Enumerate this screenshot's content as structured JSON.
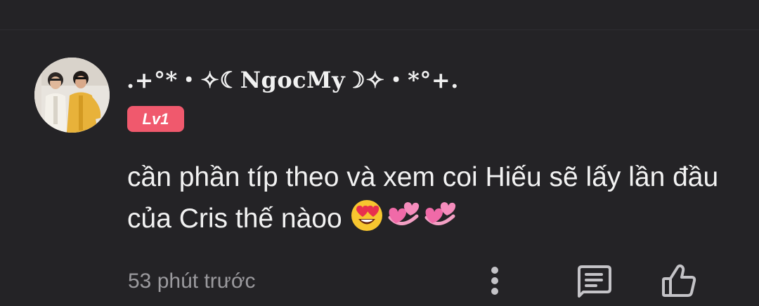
{
  "comment": {
    "username": ".+°*・✧☾NgocMy☽✧・*°+.",
    "level_badge": "Lv1",
    "text": "cần phần típ theo và xem coi Hiếu sẽ lấy lần đầu của Cris thế nàoo",
    "emojis": [
      "heart-eyes-emoji",
      "revolving-hearts-emoji",
      "revolving-hearts-emoji"
    ],
    "timestamp": "53 phút trước"
  },
  "actions": {
    "icons": [
      "more-vertical-icon",
      "reply-icon",
      "like-icon"
    ]
  },
  "colors": {
    "background": "#242326",
    "badge": "#f0596d",
    "text": "#f2f2f2",
    "muted": "#9b9a9e",
    "icon": "#c4c3c7"
  }
}
